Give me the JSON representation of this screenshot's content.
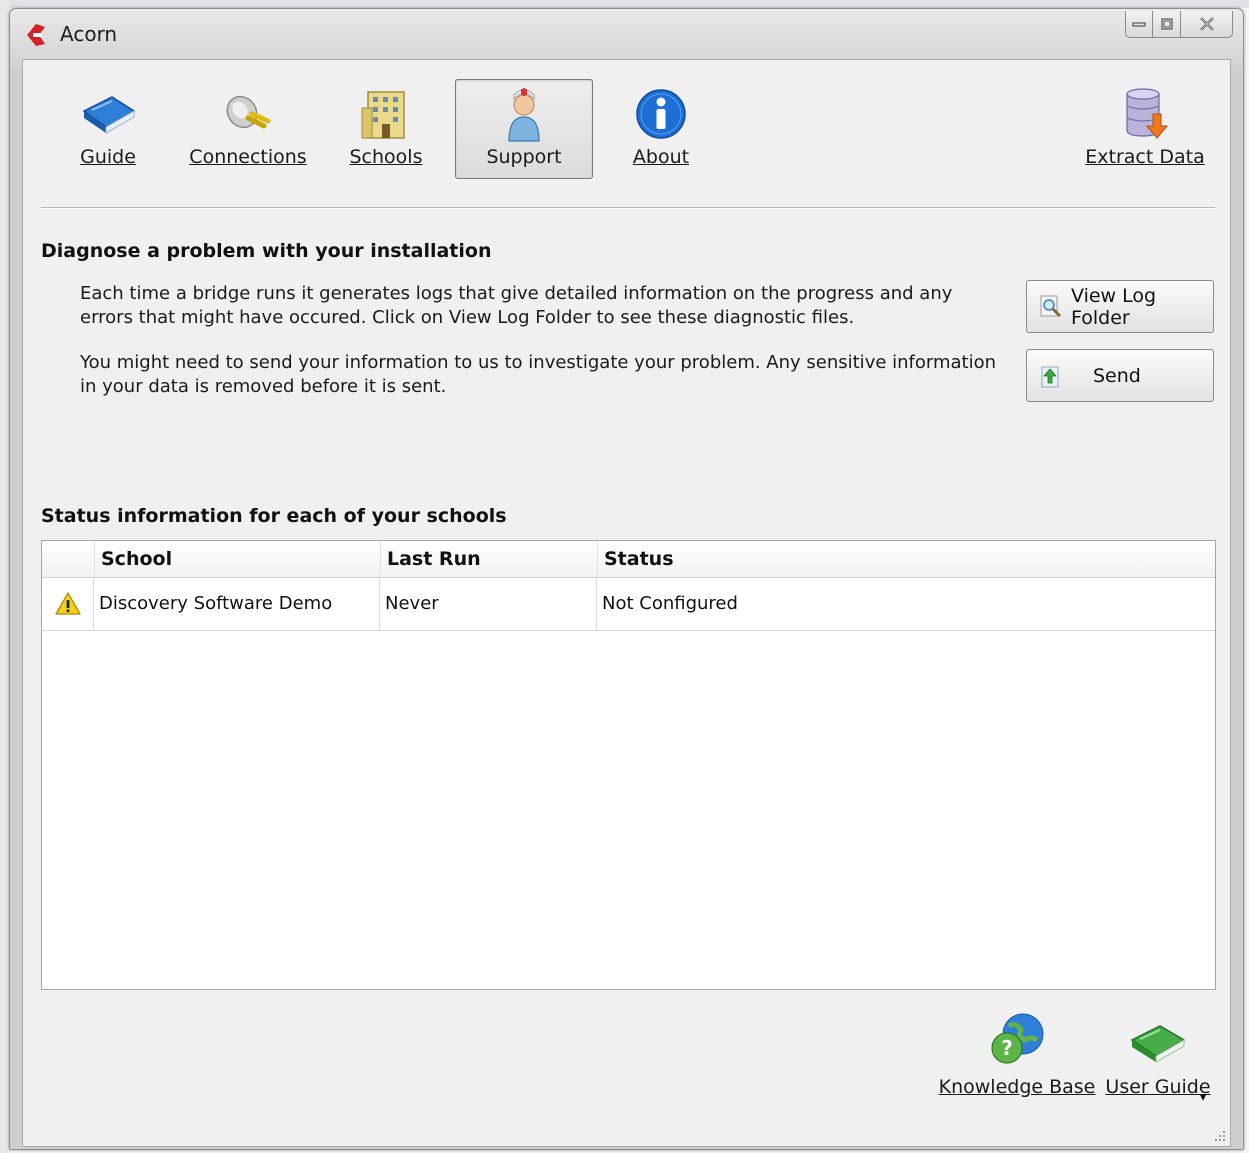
{
  "window": {
    "title": "Acorn"
  },
  "toolbar": {
    "items": [
      {
        "label": "Guide",
        "icon": "book-icon",
        "active": false
      },
      {
        "label": "Connections",
        "icon": "plug-icon",
        "active": false
      },
      {
        "label": "Schools",
        "icon": "building-icon",
        "active": false
      },
      {
        "label": "Support",
        "icon": "support-person-icon",
        "active": true
      },
      {
        "label": "About",
        "icon": "info-icon",
        "active": false
      }
    ],
    "extract": {
      "label": "Extract Data",
      "icon": "database-export-icon"
    }
  },
  "diagnose": {
    "heading": "Diagnose a problem with your installation",
    "para1": "Each time a bridge runs it generates logs that give detailed information on the progress and any errors that might have occured.  Click on View Log Folder to see these diagnostic files.",
    "para2": "You might need to send your information to us to investigate your problem.  Any sensitive information in your data is removed before it is sent.",
    "view_log_label": "View Log Folder",
    "send_label": "Send"
  },
  "status": {
    "heading": "Status information for each of your schools",
    "columns": [
      "School",
      "Last Run",
      "Status"
    ],
    "rows": [
      {
        "icon": "warning-icon",
        "school": "Discovery Software Demo",
        "last_run": "Never",
        "status": "Not Configured"
      }
    ]
  },
  "footer": {
    "knowledge_base_label": "Knowledge Base",
    "user_guide_label": "User Guide"
  },
  "colors": {
    "accent_blue": "#1d6fd6",
    "warning_yellow": "#f5c518",
    "brand_red": "#d2232a"
  }
}
